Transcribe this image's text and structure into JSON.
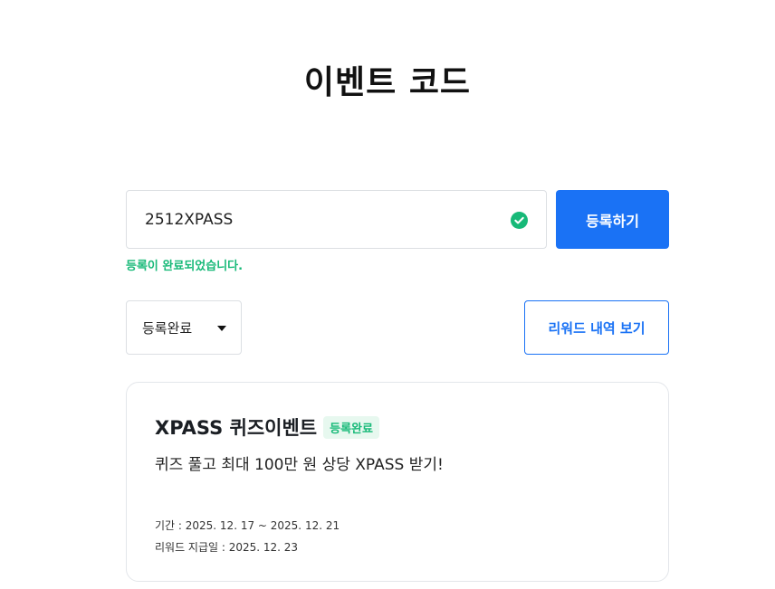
{
  "page": {
    "title": "이벤트 코드"
  },
  "code_form": {
    "input_value": "2512XPASS",
    "register_label": "등록하기",
    "success_message": "등록이 완료되었습니다."
  },
  "filter": {
    "selected": "등록완료",
    "rewards_button_label": "리워드 내역 보기"
  },
  "event": {
    "title": "XPASS 퀴즈이벤트",
    "badge": "등록완료",
    "description": "퀴즈 풀고 최대 100만 원 상당 XPASS 받기!",
    "period": "기간 : 2025. 12. 17 ~ 2025. 12. 21",
    "payout": "리워드 지급일 : 2025. 12. 23"
  },
  "colors": {
    "accent": "#1a72f5",
    "success": "#17b978"
  },
  "icons": {
    "input_status": "check-circle-icon",
    "select_caret": "caret-down-icon"
  }
}
